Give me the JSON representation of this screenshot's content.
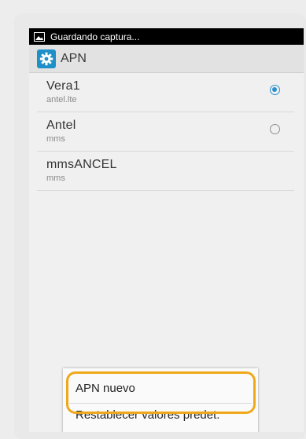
{
  "status_bar": {
    "text": "Guardando captura..."
  },
  "action_bar": {
    "title": "APN"
  },
  "apn_list": [
    {
      "name": "Vera1",
      "apn": "antel.lte",
      "selected": true
    },
    {
      "name": "Antel",
      "apn": "mms",
      "selected": false
    },
    {
      "name": "mmsANCEL",
      "apn": "mms",
      "selected": null
    }
  ],
  "menu": {
    "new_apn": "APN nuevo",
    "reset_defaults": "Restablecer valores predet."
  },
  "colors": {
    "accent": "#2a8fcf",
    "app_icon": "#1e90c8",
    "highlight": "#f0a81b"
  }
}
